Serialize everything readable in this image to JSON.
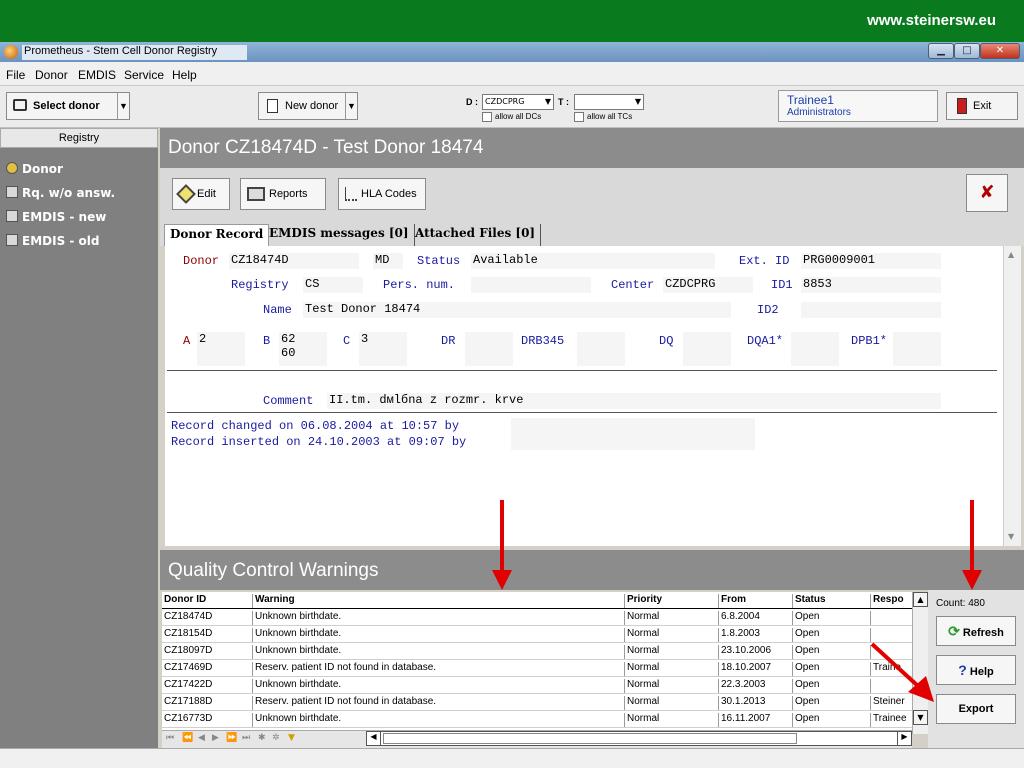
{
  "banner": {
    "url": "www.steinersw.eu"
  },
  "window": {
    "title": "Prometheus - Stem Cell Donor Registry"
  },
  "menu": [
    "File",
    "Donor",
    "EMDIS",
    "Service",
    "Help"
  ],
  "toolbar": {
    "select_donor": "Select donor",
    "new_donor": "New donor",
    "d_label": "D :",
    "d_value": "CZDCPRG",
    "t_label": "T :",
    "allow_dcs": "allow all DCs",
    "allow_tcs": "allow all TCs",
    "user_name": "Trainee1",
    "user_role": "Administrators",
    "exit": "Exit"
  },
  "sidebar": {
    "header": "Registry",
    "items": [
      "Donor",
      "Rq. w/o answ.",
      "EMDIS - new",
      "EMDIS - old"
    ]
  },
  "main": {
    "title": "Donor  CZ18474D - Test Donor 18474",
    "edit": "Edit",
    "reports": "Reports",
    "hla_codes": "HLA Codes",
    "close": "✘"
  },
  "tabs": [
    "Donor Record",
    "EMDIS messages [0]",
    "Attached Files [0]"
  ],
  "record": {
    "donor_label": "Donor",
    "donor_id": "CZ18474D",
    "md": "MD",
    "status_label": "Status",
    "status": "Available",
    "ext_id_label": "Ext. ID",
    "ext_id": "PRG0009001",
    "registry_label": "Registry",
    "registry": "CS",
    "pers_num_label": "Pers. num.",
    "center_label": "Center",
    "center": "CZDCPRG",
    "id1_label": "ID1",
    "id1": "8853",
    "name_label": "Name",
    "name": "Test Donor 18474",
    "id2_label": "ID2",
    "a_label": "A",
    "a_value": "2",
    "b_label": "B",
    "b_value1": "62",
    "b_value2": "60",
    "c_label": "C",
    "c_value": "3",
    "dr_label": "DR",
    "drb345_label": "DRB345",
    "dq_label": "DQ",
    "dqa1_label": "DQA1*",
    "dpb1_label": "DPB1*",
    "comment_label": "Comment",
    "comment": "II.tm. dмlбna z rozmr. krve",
    "changed_text": "Record changed on 06.08.2004 at 10:57 by",
    "inserted_text": "Record inserted on 24.10.2003 at 09:07 by"
  },
  "qc": {
    "title": "Quality Control Warnings",
    "columns": [
      "Donor ID",
      "Warning",
      "Priority",
      "From",
      "Status",
      "Respo"
    ],
    "rows": [
      [
        "CZ18474D",
        "Unknown birthdate.",
        "Normal",
        "6.8.2004",
        "Open",
        ""
      ],
      [
        "CZ18154D",
        "Unknown birthdate.",
        "Normal",
        "1.8.2003",
        "Open",
        ""
      ],
      [
        "CZ18097D",
        "Unknown birthdate.",
        "Normal",
        "23.10.2006",
        "Open",
        ""
      ],
      [
        "CZ17469D",
        "Reserv. patient ID not found in database.",
        "Normal",
        "18.10.2007",
        "Open",
        "Traine"
      ],
      [
        "CZ17422D",
        "Unknown birthdate.",
        "Normal",
        "22.3.2003",
        "Open",
        ""
      ],
      [
        "CZ17188D",
        "Reserv. patient ID not found in database.",
        "Normal",
        "30.1.2013",
        "Open",
        "Steiner"
      ],
      [
        "CZ16773D",
        "Unknown birthdate.",
        "Normal",
        "16.11.2007",
        "Open",
        "Trainee"
      ]
    ],
    "count": "Count: 480",
    "refresh": "Refresh",
    "help": "Help",
    "export": "Export"
  },
  "colors": {
    "banner": "#0a7a1f",
    "arrow": "#e00000",
    "header_gray": "#8c8c8c"
  }
}
